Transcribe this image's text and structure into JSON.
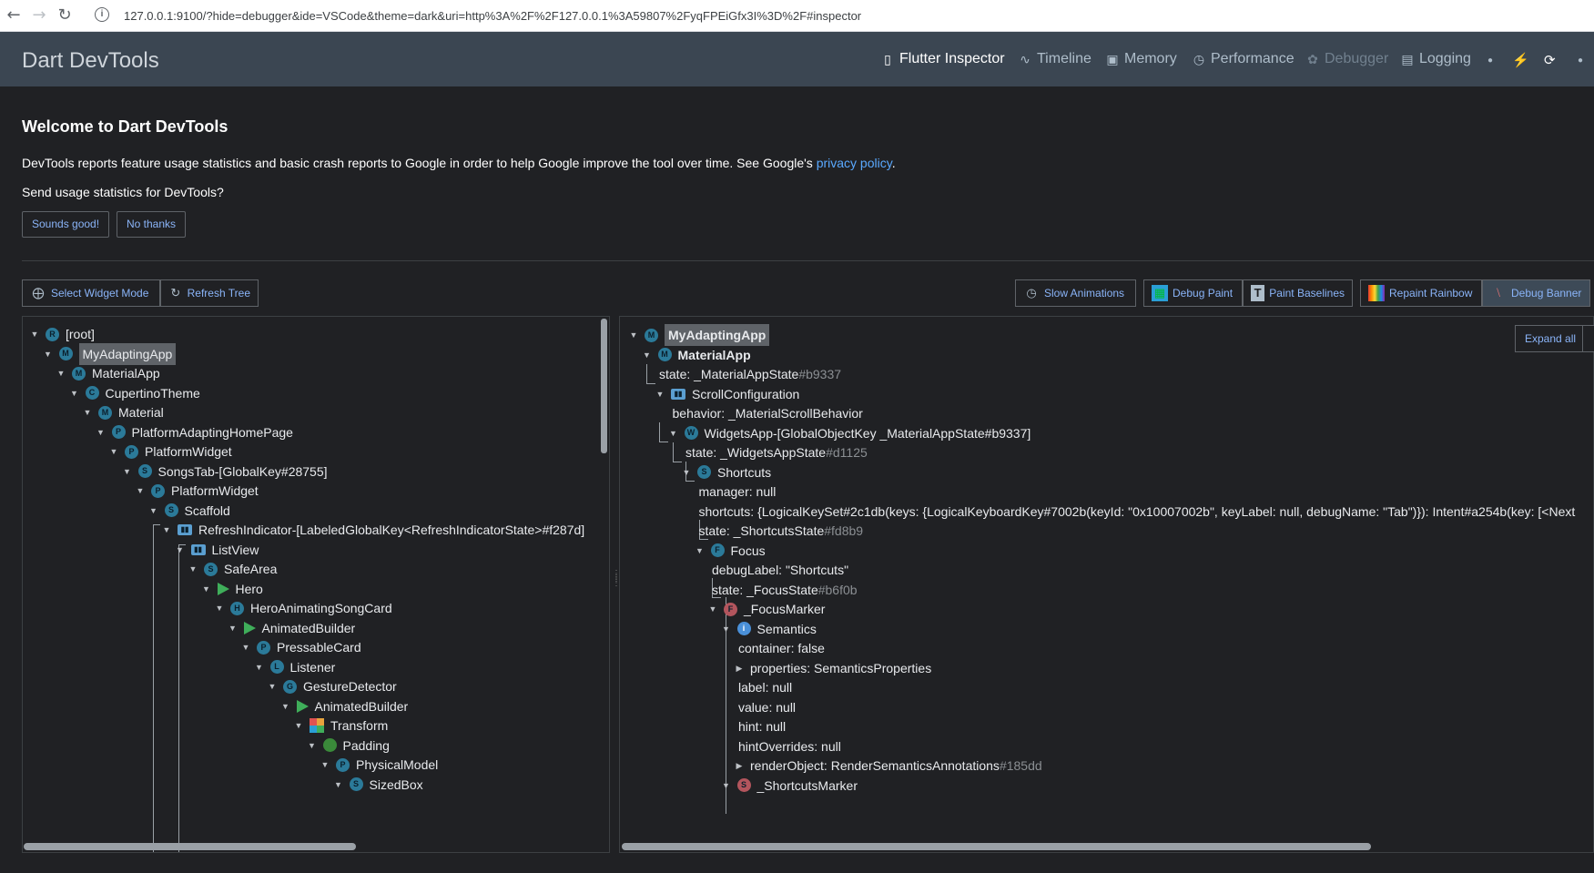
{
  "browser": {
    "back_icon": "arrow-left-icon",
    "forward_icon": "arrow-right-icon",
    "reload_icon": "reload-icon",
    "url": "127.0.0.1:9100/?hide=debugger&ide=VSCode&theme=dark&uri=http%3A%2F%2F127.0.0.1%3A59807%2FyqFPEiGfx3I%3D%2F#inspector"
  },
  "appbar": {
    "title": "Dart DevTools",
    "tabs": [
      {
        "label": "Flutter Inspector",
        "icon": "phone-icon",
        "state": "active"
      },
      {
        "label": "Timeline",
        "icon": "timeline-icon",
        "state": "normal"
      },
      {
        "label": "Memory",
        "icon": "memory-icon",
        "state": "normal"
      },
      {
        "label": "Performance",
        "icon": "performance-icon",
        "state": "normal"
      },
      {
        "label": "Debugger",
        "icon": "bug-icon",
        "state": "disabled"
      },
      {
        "label": "Logging",
        "icon": "logging-icon",
        "state": "normal"
      }
    ],
    "actions": [
      "bolt-icon",
      "hot-restart-icon"
    ]
  },
  "welcome": {
    "title": "Welcome to Dart DevTools",
    "notice_text": "DevTools reports feature usage statistics and basic crash reports to Google in order to help Google improve the tool over time. See Google's ",
    "privacy_link": "privacy policy",
    "notice_end": ".",
    "question": "Send usage statistics for DevTools?",
    "accept_label": "Sounds good!",
    "decline_label": "No thanks"
  },
  "toolbar": {
    "select_widget_mode": "Select Widget Mode",
    "refresh_tree": "Refresh Tree",
    "slow_animations": "Slow Animations",
    "debug_paint": "Debug Paint",
    "paint_baselines": "Paint Baselines",
    "repaint_rainbow": "Repaint Rainbow",
    "debug_banner": "Debug Banner"
  },
  "details": {
    "expand_all": "Expand all"
  },
  "colors": {
    "appbar": "#3b4652",
    "link": "#5aa9ff",
    "button_text": "#8ab4f8",
    "background": "#202124"
  },
  "widget_tree": [
    {
      "label": "[root]",
      "badge": "R",
      "depth": 0,
      "expanded": true
    },
    {
      "label": "MyAdaptingApp",
      "badge": "M",
      "depth": 1,
      "expanded": true,
      "selected": true
    },
    {
      "label": "MaterialApp",
      "badge": "M",
      "depth": 2,
      "expanded": true
    },
    {
      "label": "CupertinoTheme",
      "badge": "C",
      "depth": 3,
      "expanded": true
    },
    {
      "label": "Material",
      "badge": "M",
      "depth": 4,
      "expanded": true
    },
    {
      "label": "PlatformAdaptingHomePage",
      "badge": "P",
      "depth": 5,
      "expanded": true
    },
    {
      "label": "PlatformWidget",
      "badge": "P",
      "depth": 6,
      "expanded": true
    },
    {
      "label": "SongsTab-[GlobalKey#28755]",
      "badge": "S",
      "depth": 7,
      "expanded": true
    },
    {
      "label": "PlatformWidget",
      "badge": "P",
      "depth": 8,
      "expanded": true
    },
    {
      "label": "Scaffold",
      "badge": "S",
      "depth": 9,
      "expanded": true
    },
    {
      "label": "RefreshIndicator-[LabeledGlobalKey<RefreshIndicatorState>#f287d]",
      "badge": "scroll",
      "depth": 10,
      "expanded": true
    },
    {
      "label": "ListView",
      "badge": "scroll",
      "depth": 11,
      "expanded": true
    },
    {
      "label": "SafeArea",
      "badge": "S",
      "depth": 12,
      "expanded": true
    },
    {
      "label": "Hero",
      "badge": "anim",
      "depth": 13,
      "expanded": true
    },
    {
      "label": "HeroAnimatingSongCard",
      "badge": "H",
      "depth": 14,
      "expanded": true
    },
    {
      "label": "AnimatedBuilder",
      "badge": "anim",
      "depth": 15,
      "expanded": true
    },
    {
      "label": "PressableCard",
      "badge": "P",
      "depth": 16,
      "expanded": true
    },
    {
      "label": "Listener",
      "badge": "L",
      "depth": 17,
      "expanded": true
    },
    {
      "label": "GestureDetector",
      "badge": "G",
      "depth": 18,
      "expanded": true
    },
    {
      "label": "AnimatedBuilder",
      "badge": "anim",
      "depth": 19,
      "expanded": true
    },
    {
      "label": "Transform",
      "badge": "transform",
      "depth": 20,
      "expanded": true
    },
    {
      "label": "Padding",
      "badge": "padding",
      "depth": 21,
      "expanded": true
    },
    {
      "label": "PhysicalModel",
      "badge": "P",
      "depth": 22,
      "expanded": true
    },
    {
      "label": "SizedBox",
      "badge": "S",
      "depth": 23,
      "expanded": true
    }
  ],
  "details_tree": [
    {
      "kind": "node",
      "label": "MyAdaptingApp",
      "badge": "M",
      "depth": 0,
      "expanded": true,
      "bold": true,
      "selected": true
    },
    {
      "kind": "node",
      "label": "MaterialApp",
      "badge": "M",
      "depth": 1,
      "expanded": true,
      "bold": true
    },
    {
      "kind": "prop",
      "label": "state: _MaterialAppState",
      "hash": "#b9337",
      "depth": 2
    },
    {
      "kind": "node",
      "label": "ScrollConfiguration",
      "badge": "scroll",
      "depth": 2,
      "expanded": true
    },
    {
      "kind": "prop",
      "label": "behavior: _MaterialScrollBehavior",
      "depth": 3
    },
    {
      "kind": "node",
      "label": "WidgetsApp-[GlobalObjectKey _MaterialAppState#b9337]",
      "badge": "W",
      "depth": 3,
      "expanded": true
    },
    {
      "kind": "prop",
      "label": "state: _WidgetsAppState",
      "hash": "#d1125",
      "depth": 4
    },
    {
      "kind": "node",
      "label": "Shortcuts",
      "badge": "S",
      "depth": 4,
      "expanded": true
    },
    {
      "kind": "prop",
      "label": "manager: null",
      "depth": 5
    },
    {
      "kind": "prop",
      "label": "shortcuts: {LogicalKeySet#2c1db(keys: {LogicalKeyboardKey#7002b(keyId: \"0x10007002b\", keyLabel: null, debugName: \"Tab\")}): Intent#a254b(key: [<Next",
      "depth": 5
    },
    {
      "kind": "prop",
      "label": "state: _ShortcutsState",
      "hash": "#fd8b9",
      "depth": 5
    },
    {
      "kind": "node",
      "label": "Focus",
      "badge": "F",
      "depth": 5,
      "expanded": true
    },
    {
      "kind": "prop",
      "label": "debugLabel: \"Shortcuts\"",
      "depth": 6
    },
    {
      "kind": "prop",
      "label": "state: _FocusState",
      "hash": "#b6f0b",
      "depth": 6
    },
    {
      "kind": "node",
      "label": "_FocusMarker",
      "badge": "F-red",
      "depth": 6,
      "expanded": true
    },
    {
      "kind": "node",
      "label": "Semantics",
      "badge": "info",
      "depth": 7,
      "expanded": true
    },
    {
      "kind": "prop",
      "label": "container: false",
      "depth": 8
    },
    {
      "kind": "propnode",
      "label": "properties: SemanticsProperties",
      "depth": 8
    },
    {
      "kind": "prop",
      "label": "label: null",
      "depth": 8
    },
    {
      "kind": "prop",
      "label": "value: null",
      "depth": 8
    },
    {
      "kind": "prop",
      "label": "hint: null",
      "depth": 8
    },
    {
      "kind": "prop",
      "label": "hintOverrides: null",
      "depth": 8
    },
    {
      "kind": "propnode",
      "label": "renderObject: RenderSemanticsAnnotations",
      "hash": "#185dd",
      "depth": 8
    },
    {
      "kind": "node",
      "label": "_ShortcutsMarker",
      "badge": "S-red",
      "depth": 7,
      "expanded": true
    }
  ]
}
